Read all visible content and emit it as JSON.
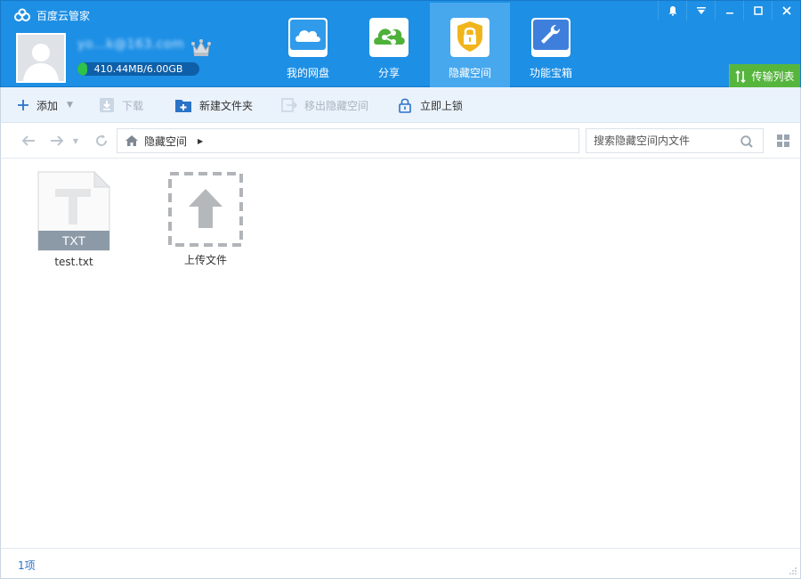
{
  "app": {
    "title": "百度云管家",
    "logo_icon": "baidu-cloud-logo-icon"
  },
  "user": {
    "account": "yo...k@163.com",
    "quota_text": "410.44MB/6.00GB",
    "quota_used_fraction": 0.067,
    "vip_icon": "crown-icon"
  },
  "nav": {
    "tabs": [
      {
        "label": "我的网盘",
        "icon": "cloud-drive-icon",
        "active": false
      },
      {
        "label": "分享",
        "icon": "share-icon",
        "active": false
      },
      {
        "label": "隐藏空间",
        "icon": "lock-shield-icon",
        "active": true
      },
      {
        "label": "功能宝箱",
        "icon": "wrench-toolbox-icon",
        "active": false
      }
    ]
  },
  "window": {
    "controls": [
      "bell-icon",
      "menu-icon",
      "minimize-icon",
      "maximize-icon",
      "close-icon"
    ]
  },
  "transfer": {
    "label": "传输列表"
  },
  "toolbar": {
    "add_label": "添加",
    "download_label": "下载",
    "new_folder_label": "新建文件夹",
    "move_out_label": "移出隐藏空间",
    "lock_label": "立即上锁"
  },
  "addressbar": {
    "path_label": "隐藏空间",
    "search_placeholder": "搜索隐藏空间内文件"
  },
  "files": [
    {
      "name": "test.txt",
      "type_label": "TXT"
    },
    {
      "name": "上传文件"
    }
  ],
  "status": {
    "item_count": "1项"
  },
  "colors": {
    "header_blue": "#1d8fe5",
    "active_tab": "#47a8ee",
    "transfer_green": "#56b53d",
    "toolbar_bg": "#eaf2fb"
  }
}
